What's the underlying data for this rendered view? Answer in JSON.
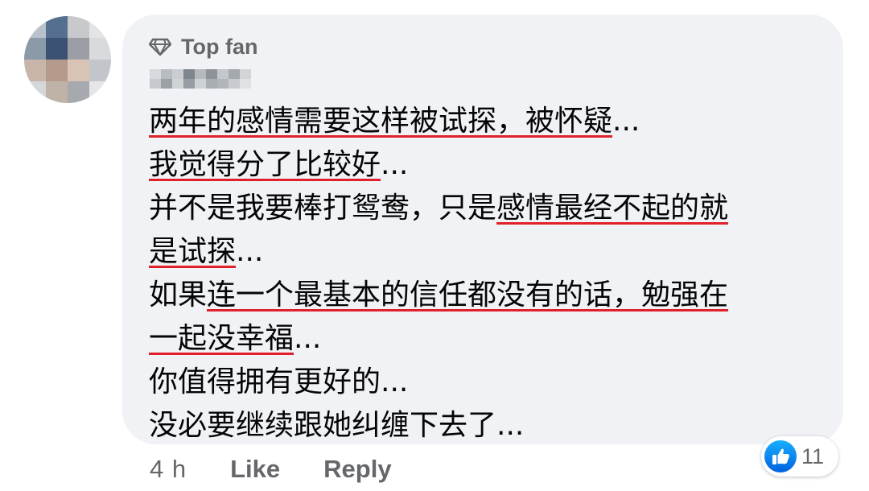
{
  "comment": {
    "badge_label": "Top fan",
    "lines": [
      {
        "before": "",
        "underlined": "两年的感情需要这样被试探，被怀疑",
        "after": "..."
      },
      {
        "before": "",
        "underlined": "我觉得分了比较好",
        "after": "..."
      },
      {
        "before": "并不是我要棒打鸳鸯，只是",
        "underlined": "感情最经不起的就",
        "after": ""
      },
      {
        "before": "",
        "underlined": "是试探",
        "after": "..."
      },
      {
        "before": "如果",
        "underlined": "连一个最基本的信任都没有的话，勉强在",
        "after": ""
      },
      {
        "before": "",
        "underlined": "一起没幸福",
        "after": "..."
      },
      {
        "before": "你值得拥有更好的...",
        "underlined": "",
        "after": ""
      },
      {
        "before": "没必要继续跟她纠缠下去了...",
        "underlined": "",
        "after": ""
      }
    ],
    "underline_color": "#e0202a"
  },
  "actions": {
    "time": "4 h",
    "like_label": "Like",
    "reply_label": "Reply"
  },
  "reactions": {
    "count": "11",
    "icon": "thumbs-up-icon",
    "color": "#1877f2"
  },
  "colors": {
    "bubble_bg": "#f0f2f5",
    "meta_text": "#65676b",
    "body_text": "#050505"
  }
}
